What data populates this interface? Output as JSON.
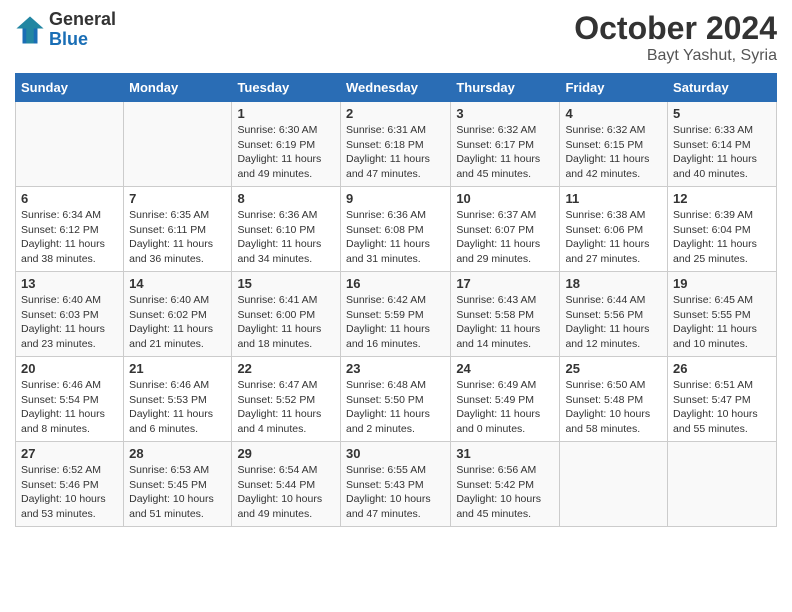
{
  "header": {
    "logo_general": "General",
    "logo_blue": "Blue",
    "month_title": "October 2024",
    "subtitle": "Bayt Yashut, Syria"
  },
  "days_of_week": [
    "Sunday",
    "Monday",
    "Tuesday",
    "Wednesday",
    "Thursday",
    "Friday",
    "Saturday"
  ],
  "weeks": [
    [
      {
        "day": "",
        "detail": ""
      },
      {
        "day": "",
        "detail": ""
      },
      {
        "day": "1",
        "detail": "Sunrise: 6:30 AM\nSunset: 6:19 PM\nDaylight: 11 hours and 49 minutes."
      },
      {
        "day": "2",
        "detail": "Sunrise: 6:31 AM\nSunset: 6:18 PM\nDaylight: 11 hours and 47 minutes."
      },
      {
        "day": "3",
        "detail": "Sunrise: 6:32 AM\nSunset: 6:17 PM\nDaylight: 11 hours and 45 minutes."
      },
      {
        "day": "4",
        "detail": "Sunrise: 6:32 AM\nSunset: 6:15 PM\nDaylight: 11 hours and 42 minutes."
      },
      {
        "day": "5",
        "detail": "Sunrise: 6:33 AM\nSunset: 6:14 PM\nDaylight: 11 hours and 40 minutes."
      }
    ],
    [
      {
        "day": "6",
        "detail": "Sunrise: 6:34 AM\nSunset: 6:12 PM\nDaylight: 11 hours and 38 minutes."
      },
      {
        "day": "7",
        "detail": "Sunrise: 6:35 AM\nSunset: 6:11 PM\nDaylight: 11 hours and 36 minutes."
      },
      {
        "day": "8",
        "detail": "Sunrise: 6:36 AM\nSunset: 6:10 PM\nDaylight: 11 hours and 34 minutes."
      },
      {
        "day": "9",
        "detail": "Sunrise: 6:36 AM\nSunset: 6:08 PM\nDaylight: 11 hours and 31 minutes."
      },
      {
        "day": "10",
        "detail": "Sunrise: 6:37 AM\nSunset: 6:07 PM\nDaylight: 11 hours and 29 minutes."
      },
      {
        "day": "11",
        "detail": "Sunrise: 6:38 AM\nSunset: 6:06 PM\nDaylight: 11 hours and 27 minutes."
      },
      {
        "day": "12",
        "detail": "Sunrise: 6:39 AM\nSunset: 6:04 PM\nDaylight: 11 hours and 25 minutes."
      }
    ],
    [
      {
        "day": "13",
        "detail": "Sunrise: 6:40 AM\nSunset: 6:03 PM\nDaylight: 11 hours and 23 minutes."
      },
      {
        "day": "14",
        "detail": "Sunrise: 6:40 AM\nSunset: 6:02 PM\nDaylight: 11 hours and 21 minutes."
      },
      {
        "day": "15",
        "detail": "Sunrise: 6:41 AM\nSunset: 6:00 PM\nDaylight: 11 hours and 18 minutes."
      },
      {
        "day": "16",
        "detail": "Sunrise: 6:42 AM\nSunset: 5:59 PM\nDaylight: 11 hours and 16 minutes."
      },
      {
        "day": "17",
        "detail": "Sunrise: 6:43 AM\nSunset: 5:58 PM\nDaylight: 11 hours and 14 minutes."
      },
      {
        "day": "18",
        "detail": "Sunrise: 6:44 AM\nSunset: 5:56 PM\nDaylight: 11 hours and 12 minutes."
      },
      {
        "day": "19",
        "detail": "Sunrise: 6:45 AM\nSunset: 5:55 PM\nDaylight: 11 hours and 10 minutes."
      }
    ],
    [
      {
        "day": "20",
        "detail": "Sunrise: 6:46 AM\nSunset: 5:54 PM\nDaylight: 11 hours and 8 minutes."
      },
      {
        "day": "21",
        "detail": "Sunrise: 6:46 AM\nSunset: 5:53 PM\nDaylight: 11 hours and 6 minutes."
      },
      {
        "day": "22",
        "detail": "Sunrise: 6:47 AM\nSunset: 5:52 PM\nDaylight: 11 hours and 4 minutes."
      },
      {
        "day": "23",
        "detail": "Sunrise: 6:48 AM\nSunset: 5:50 PM\nDaylight: 11 hours and 2 minutes."
      },
      {
        "day": "24",
        "detail": "Sunrise: 6:49 AM\nSunset: 5:49 PM\nDaylight: 11 hours and 0 minutes."
      },
      {
        "day": "25",
        "detail": "Sunrise: 6:50 AM\nSunset: 5:48 PM\nDaylight: 10 hours and 58 minutes."
      },
      {
        "day": "26",
        "detail": "Sunrise: 6:51 AM\nSunset: 5:47 PM\nDaylight: 10 hours and 55 minutes."
      }
    ],
    [
      {
        "day": "27",
        "detail": "Sunrise: 6:52 AM\nSunset: 5:46 PM\nDaylight: 10 hours and 53 minutes."
      },
      {
        "day": "28",
        "detail": "Sunrise: 6:53 AM\nSunset: 5:45 PM\nDaylight: 10 hours and 51 minutes."
      },
      {
        "day": "29",
        "detail": "Sunrise: 6:54 AM\nSunset: 5:44 PM\nDaylight: 10 hours and 49 minutes."
      },
      {
        "day": "30",
        "detail": "Sunrise: 6:55 AM\nSunset: 5:43 PM\nDaylight: 10 hours and 47 minutes."
      },
      {
        "day": "31",
        "detail": "Sunrise: 6:56 AM\nSunset: 5:42 PM\nDaylight: 10 hours and 45 minutes."
      },
      {
        "day": "",
        "detail": ""
      },
      {
        "day": "",
        "detail": ""
      }
    ]
  ]
}
